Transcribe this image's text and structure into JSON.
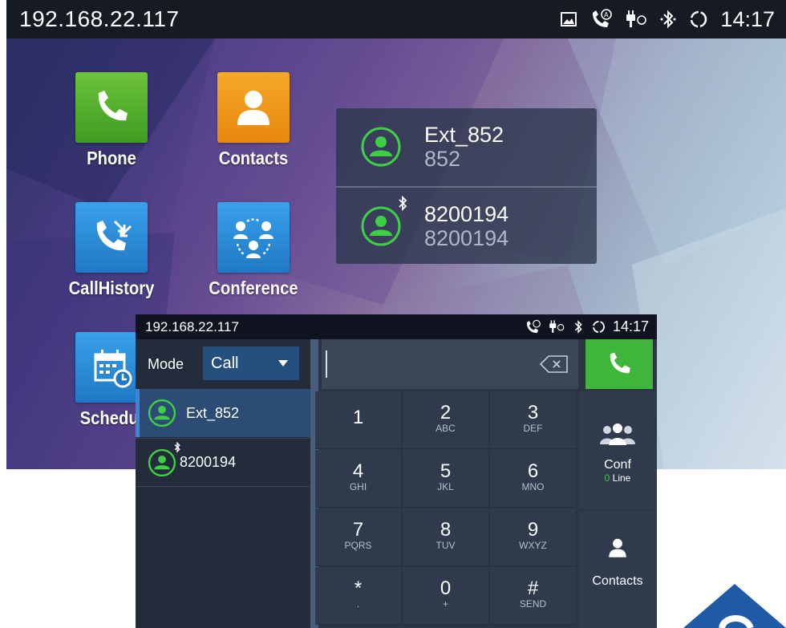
{
  "home": {
    "status_bar": {
      "ip": "192.168.22.117",
      "time": "14:17"
    },
    "apps": [
      {
        "label": "Phone",
        "color": "#5bb532",
        "icon": "phone-icon"
      },
      {
        "label": "Contacts",
        "color": "#f19a1f",
        "icon": "contact-person-icon"
      },
      {
        "label": "CallHistory",
        "color": "#2c8fdc",
        "icon": "call-history-icon"
      },
      {
        "label": "Conference",
        "color": "#2c8fdc",
        "icon": "conference-icon"
      },
      {
        "label": "Schedul",
        "color": "#2c8fdc",
        "icon": "calendar-icon"
      }
    ],
    "favorites": [
      {
        "name": "Ext_852",
        "number": "852",
        "bluetooth": false
      },
      {
        "name": "8200194",
        "number": "8200194",
        "bluetooth": true
      }
    ]
  },
  "dialer": {
    "status_bar": {
      "ip": "192.168.22.117",
      "time": "14:17"
    },
    "mode_label": "Mode",
    "mode_value": "Call",
    "contacts": [
      {
        "name": "Ext_852",
        "selected": true,
        "bluetooth": false
      },
      {
        "name": "8200194",
        "selected": false,
        "bluetooth": true
      }
    ],
    "number_input": "",
    "keys": [
      {
        "digit": "1",
        "letters": ""
      },
      {
        "digit": "2",
        "letters": "ABC"
      },
      {
        "digit": "3",
        "letters": "DEF"
      },
      {
        "digit": "4",
        "letters": "GHI"
      },
      {
        "digit": "5",
        "letters": "JKL"
      },
      {
        "digit": "6",
        "letters": "MNO"
      },
      {
        "digit": "7",
        "letters": "PQRS"
      },
      {
        "digit": "8",
        "letters": "TUV"
      },
      {
        "digit": "9",
        "letters": "WXYZ"
      },
      {
        "digit": "*",
        "letters": "."
      },
      {
        "digit": "0",
        "letters": "+"
      },
      {
        "digit": "#",
        "letters": "SEND"
      }
    ],
    "conf": {
      "label": "Conf",
      "line_count": "0",
      "line_label": "Line"
    },
    "contacts_button": "Contacts",
    "colors": {
      "call_green": "#3fb53a",
      "accent_blue": "#3a86d8"
    }
  }
}
